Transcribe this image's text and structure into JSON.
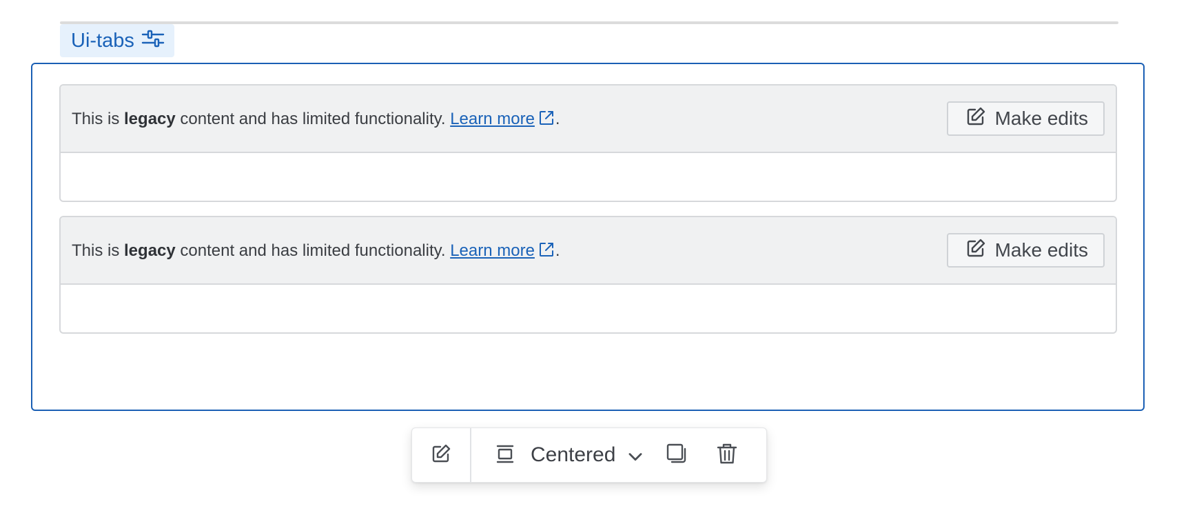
{
  "macro": {
    "tag_label": "Ui-tabs",
    "tag_icon": "sliders-icon"
  },
  "panels": [
    {
      "text_before": "This is ",
      "text_bold": "legacy",
      "text_after": " content and has limited functionality. ",
      "link_label": "Learn more",
      "trailing": ".",
      "button_label": "Make edits"
    },
    {
      "text_before": "This is ",
      "text_bold": "legacy",
      "text_after": " content and has limited functionality. ",
      "link_label": "Learn more",
      "trailing": ".",
      "button_label": "Make edits"
    }
  ],
  "toolbar": {
    "edit_icon": "pencil-icon",
    "layout_icon": "centered-layout-icon",
    "layout_label": "Centered",
    "chevron_icon": "chevron-down-icon",
    "copy_icon": "copy-icon",
    "delete_icon": "trash-icon"
  },
  "colors": {
    "accent": "#1a62b8",
    "selection_border": "#1a5fb4",
    "tag_bg": "#e6f1fc",
    "panel_head_bg": "#f0f1f2"
  }
}
